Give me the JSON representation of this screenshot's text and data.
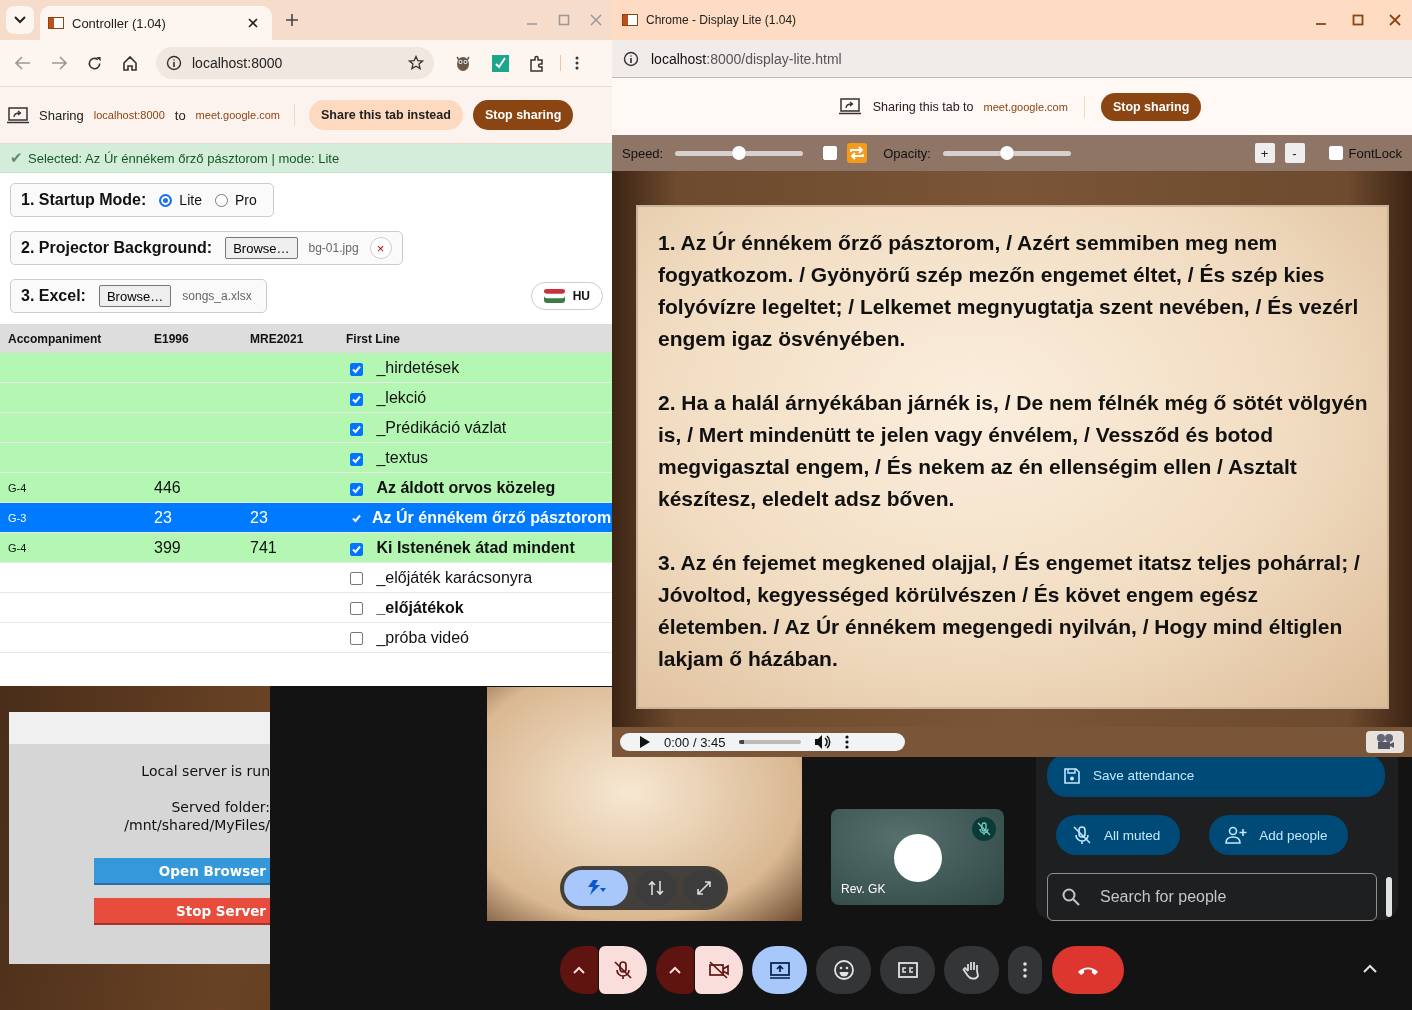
{
  "controller": {
    "tab_title": "Controller (1.04)",
    "url": "localhost:8000",
    "sharing": {
      "label": "Sharing",
      "source": "localhost:8000",
      "joiner": "to",
      "target": "meet.google.com",
      "switch_button": "Share this tab instead",
      "stop_button": "Stop sharing"
    },
    "status": {
      "icon": "✔",
      "text": "Selected: Az Úr énnékem őrző pásztorom | mode: Lite"
    },
    "startup_mode": {
      "label": "1. Startup Mode:",
      "options": [
        {
          "label": "Lite",
          "selected": true
        },
        {
          "label": "Pro",
          "selected": false
        }
      ]
    },
    "background": {
      "label": "2. Projector Background:",
      "browse": "Browse…",
      "file": "bg-01.jpg",
      "clear": "×"
    },
    "excel": {
      "label": "3. Excel:",
      "browse": "Browse…",
      "file": "songs_a.xlsx"
    },
    "language": "HU",
    "table": {
      "columns": [
        "Accompaniment",
        "E1996",
        "MRE2021",
        "First Line"
      ],
      "rows": [
        {
          "first_line": "_hirdetések",
          "checked": true,
          "bold": false,
          "selected": false
        },
        {
          "first_line": "_lekció",
          "checked": true,
          "bold": false,
          "selected": false
        },
        {
          "first_line": "_Prédikáció vázlat",
          "checked": true,
          "bold": false,
          "selected": false
        },
        {
          "first_line": "_textus",
          "checked": true,
          "bold": false,
          "selected": false
        },
        {
          "accompaniment": "G-4",
          "e1996": "446",
          "first_line": "Az áldott orvos közeleg",
          "checked": true,
          "bold": true,
          "selected": false
        },
        {
          "accompaniment": "G-3",
          "e1996": "23",
          "mre2021": "23",
          "first_line": "Az Úr énnékem őrző pásztorom",
          "checked": true,
          "bold": true,
          "selected": true
        },
        {
          "accompaniment": "G-4",
          "e1996": "399",
          "mre2021": "741",
          "first_line": "Ki Istenének átad mindent",
          "checked": true,
          "bold": true,
          "selected": false
        },
        {
          "first_line": "_előjáték karácsonyra",
          "checked": false,
          "bold": false,
          "selected": false
        },
        {
          "first_line": "_előjátékok",
          "checked": false,
          "bold": true,
          "selected": false
        },
        {
          "first_line": "_próba videó",
          "checked": false,
          "bold": false,
          "selected": false
        }
      ]
    }
  },
  "display": {
    "title": "Chrome - Display Lite (1.04)",
    "url_host": "localhost",
    "url_rest": ":8000/display-lite.html",
    "sharing": {
      "label": "Sharing this tab to",
      "target": "meet.google.com",
      "stop_button": "Stop sharing"
    },
    "controls": {
      "speed_label": "Speed:",
      "speed": {
        "level": 0.5
      },
      "auto_scroll": {
        "checked": false
      },
      "opacity_label": "Opacity:",
      "opacity": {
        "level": 0.5
      },
      "font_up": "+",
      "font_down": "-",
      "font_lock": {
        "label": "FontLock",
        "checked": false
      }
    },
    "stanzas": [
      "1. Az Úr énnékem őrző pásztorom, / Azért semmiben meg nem fogyatkozom. / Gyönyörű szép mezőn engemet éltet, / És szép kies folyóvízre legeltet; / Lelkemet megnyugtatja szent nevében, / És vezérl engem igaz ösvényében.",
      "2. Ha a halál árnyékában járnék is, / De nem félnék még ő sötét völgyén is, / Mert mindenütt te jelen vagy énvélem, / Vessződ és botod megvigasztal engem, / És nekem az én ellenségim ellen / Asztalt készítesz, eledelt adsz bőven.",
      "3. Az én fejemet megkened olajjal, / És engemet itatsz teljes pohárral; / Jóvoltod, kegyességed körülvészen / És követ engem egész életemben. / Az Úr énnékem megengedi nyilván, / Hogy mind éltiglen lakjam ő házában."
    ],
    "player": {
      "time": "0:00 / 3:45",
      "level": 0.08
    }
  },
  "server_dialog": {
    "status": "Local server is run",
    "folder_label": "Served folder:",
    "folder_path": "/mnt/shared/MyFiles/",
    "open_button": "Open Browser",
    "stop_button": "Stop Server"
  },
  "meet": {
    "participant": {
      "name": "Rev. GK",
      "muted": true
    },
    "panel": {
      "save": "Save attendance",
      "mute_all": "All muted",
      "add": "Add people",
      "search_placeholder": "Search for people"
    },
    "controls": {
      "mic_on": false,
      "camera_on": false,
      "presenting": true
    }
  }
}
